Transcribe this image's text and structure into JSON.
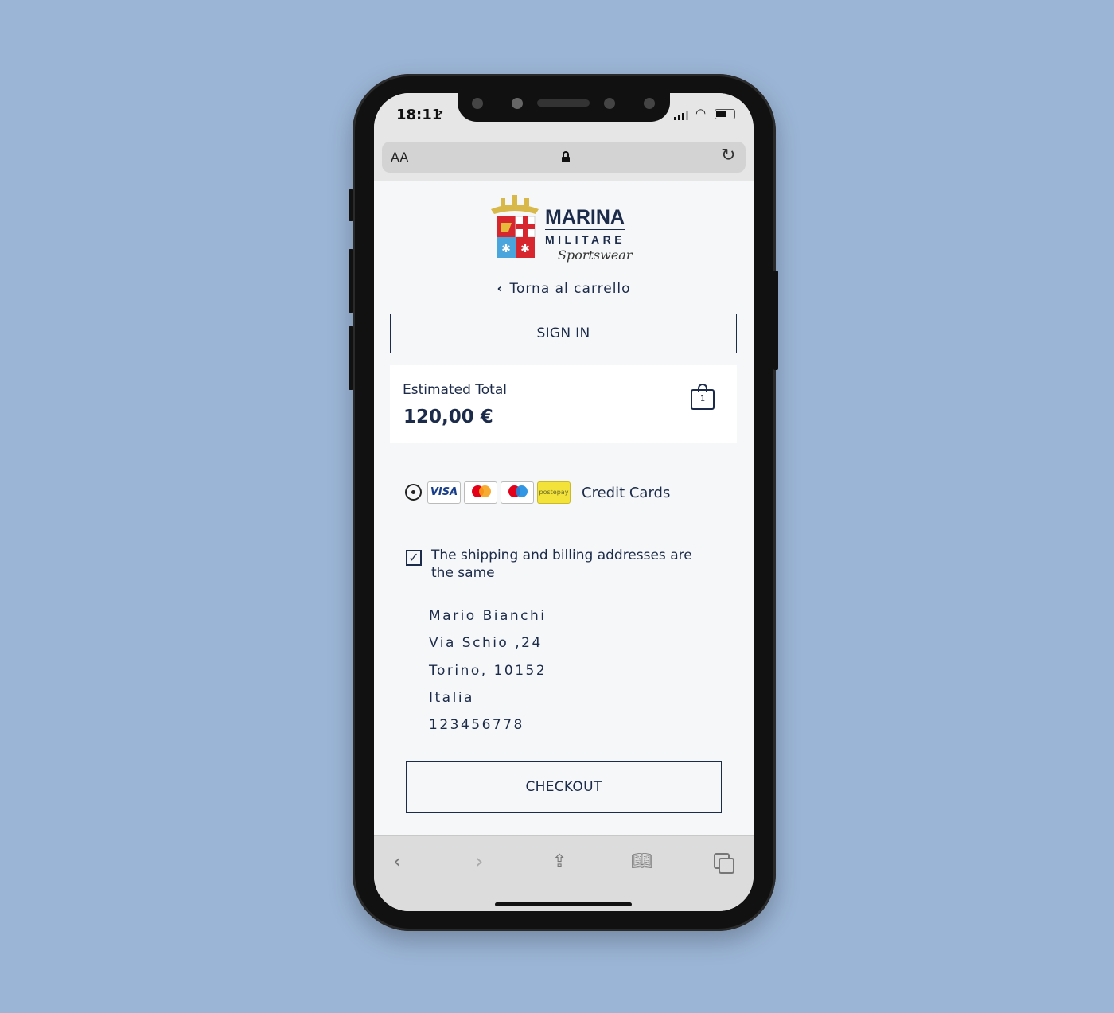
{
  "status_bar": {
    "time": "18:11"
  },
  "browser": {
    "text_size_label": "AA",
    "lock_icon": "lock-icon",
    "reload_icon": "reload-icon"
  },
  "brand": {
    "line1": "MARINA",
    "line2": "MILITARE",
    "line3": "Sportswear"
  },
  "nav": {
    "back_label": "Torna al carrello"
  },
  "sign_in": {
    "label": "SIGN IN"
  },
  "summary": {
    "label": "Estimated Total",
    "total": "120,00 €",
    "cart_count": "1"
  },
  "payment": {
    "option_label": "Credit Cards",
    "cards": [
      "VISA",
      "mastercard",
      "maestro",
      "postepay"
    ],
    "selected": true
  },
  "billing": {
    "same_address_label": "The shipping and billing addresses are the same",
    "checked": true
  },
  "address": {
    "name": "Mario Bianchi",
    "street": "Via Schio ,24",
    "city": "Torino, 10152",
    "country": "Italia",
    "phone": "123456778"
  },
  "checkout": {
    "label": "CHECKOUT"
  },
  "colors": {
    "background": "#9bb5d6",
    "text": "#1c2b4a",
    "postepay": "#f3e23a"
  }
}
